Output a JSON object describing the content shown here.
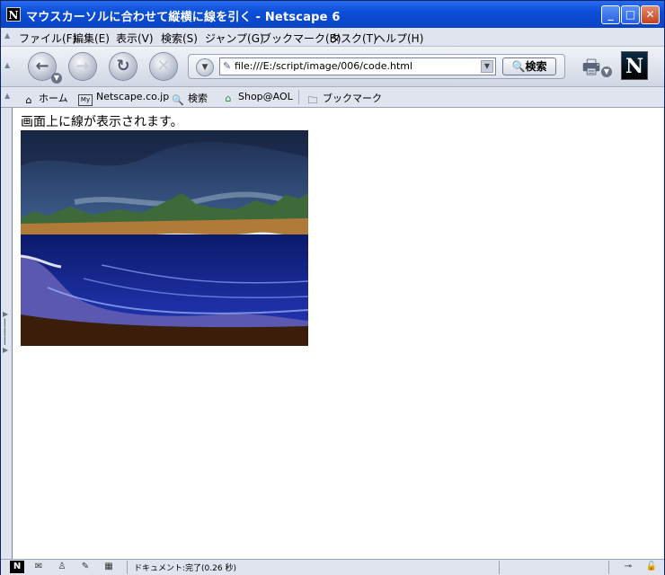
{
  "window": {
    "app_icon": "N",
    "title": "マウスカーソルに合わせて縦横に線を引く - Netscape 6",
    "buttons": {
      "minimize": "_",
      "maximize": "□",
      "close": "✕"
    }
  },
  "menu": {
    "items": [
      "ファイル(F)",
      "編集(E)",
      "表示(V)",
      "検索(S)",
      "ジャンプ(G)",
      "ブックマーク(B)",
      "タスク(T)",
      "ヘルプ(H)"
    ]
  },
  "navigation": {
    "back_icon": "←",
    "forward_icon": "→",
    "reload_icon": "↻",
    "stop_icon": "✕",
    "url": "file:///E:/script/image/006/code.html",
    "search_button": "検索",
    "logo_letter": "N"
  },
  "personal_toolbar": {
    "items": [
      {
        "icon": "home-icon",
        "label": "ホーム"
      },
      {
        "icon": "my-icon",
        "label": "Netscape.co.jp"
      },
      {
        "icon": "search-icon",
        "label": "検索"
      },
      {
        "icon": "shop-icon",
        "label": "Shop@AOL"
      },
      {
        "icon": "folder-icon",
        "label": "ブックマーク"
      }
    ]
  },
  "page": {
    "message": "画面上に線が表示されます。"
  },
  "status": {
    "text": "ドキュメント:完了(0.26 秒)"
  },
  "colors": {
    "title_bar": "#0b4fd8",
    "chrome": "#dfe4ee",
    "content_bg": "#ffffff"
  }
}
